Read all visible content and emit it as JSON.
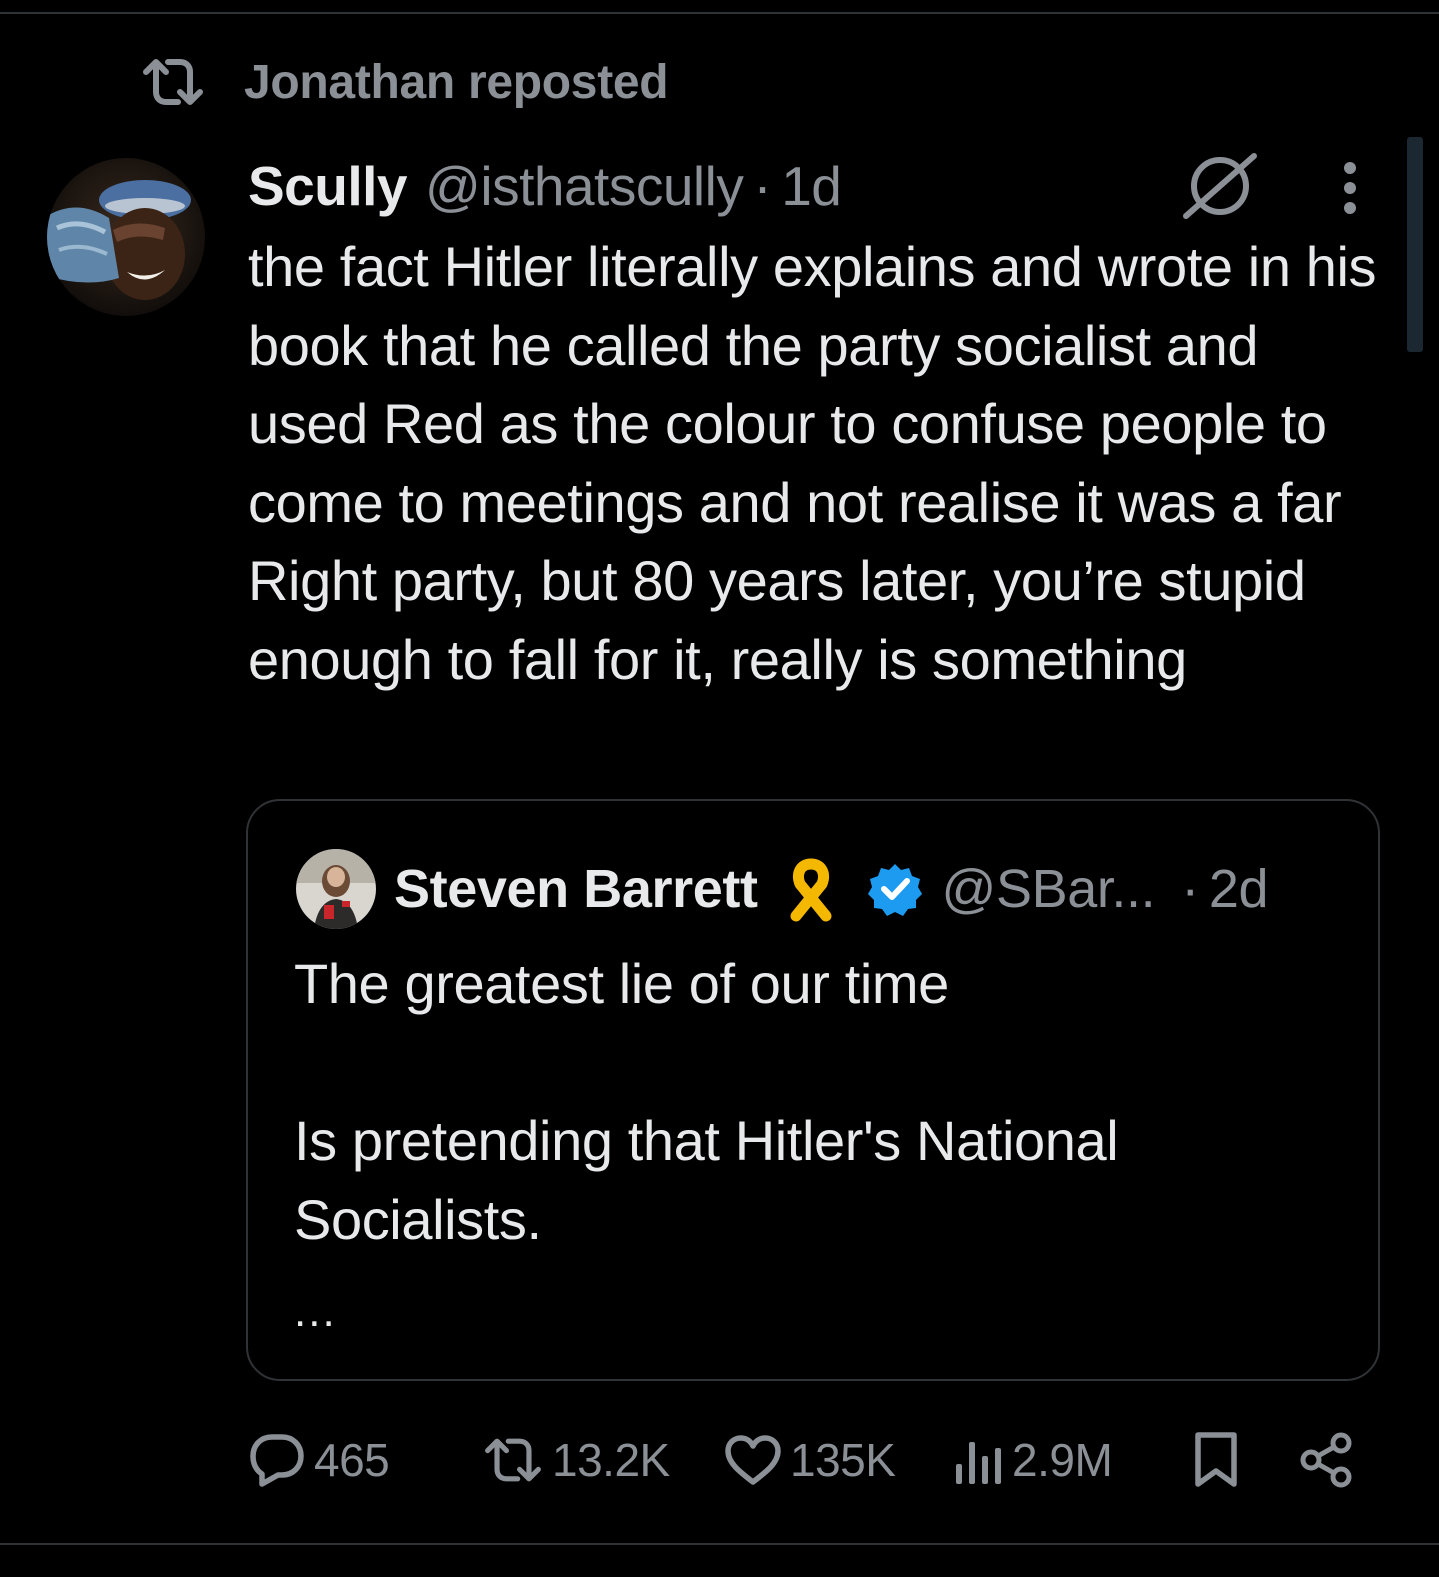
{
  "repost": {
    "label": "Jonathan reposted"
  },
  "tweet": {
    "author_name": "Scully",
    "author_handle": "@isthatscully",
    "separator": "·",
    "timestamp": "1d",
    "body": "the fact Hitler literally explains and wrote in his book that he called the party socialist and used Red as the colour to confuse people to come to meetings and not realise it was a far Right party, but 80 years later, you’re stupid enough to fall for it, really is something"
  },
  "quote": {
    "author_name": "Steven Barrett",
    "author_handle": "@SBar...",
    "separator": "·",
    "timestamp": "2d",
    "line1": "The greatest lie of our time",
    "line2": "Is pretending that Hitler's National Socialists.",
    "ellipsis": "..."
  },
  "actions": {
    "replies": "465",
    "reposts": "13.2K",
    "likes": "135K",
    "views": "2.9M"
  },
  "icons": {
    "repost": "repost-icon",
    "grok": "grok-icon",
    "more": "more-vertical-icon",
    "ribbon": "yellow-ribbon-icon",
    "verified": "verified-badge-icon",
    "reply": "reply-icon",
    "like": "heart-icon",
    "views": "views-chart-icon",
    "bookmark": "bookmark-icon",
    "share": "share-icon"
  },
  "colors": {
    "background": "#000000",
    "text_primary": "#e7e9ea",
    "text_secondary": "#8b9096",
    "border": "#2f3336",
    "verified_blue": "#1d9bf0",
    "ribbon_yellow": "#f5b800"
  }
}
